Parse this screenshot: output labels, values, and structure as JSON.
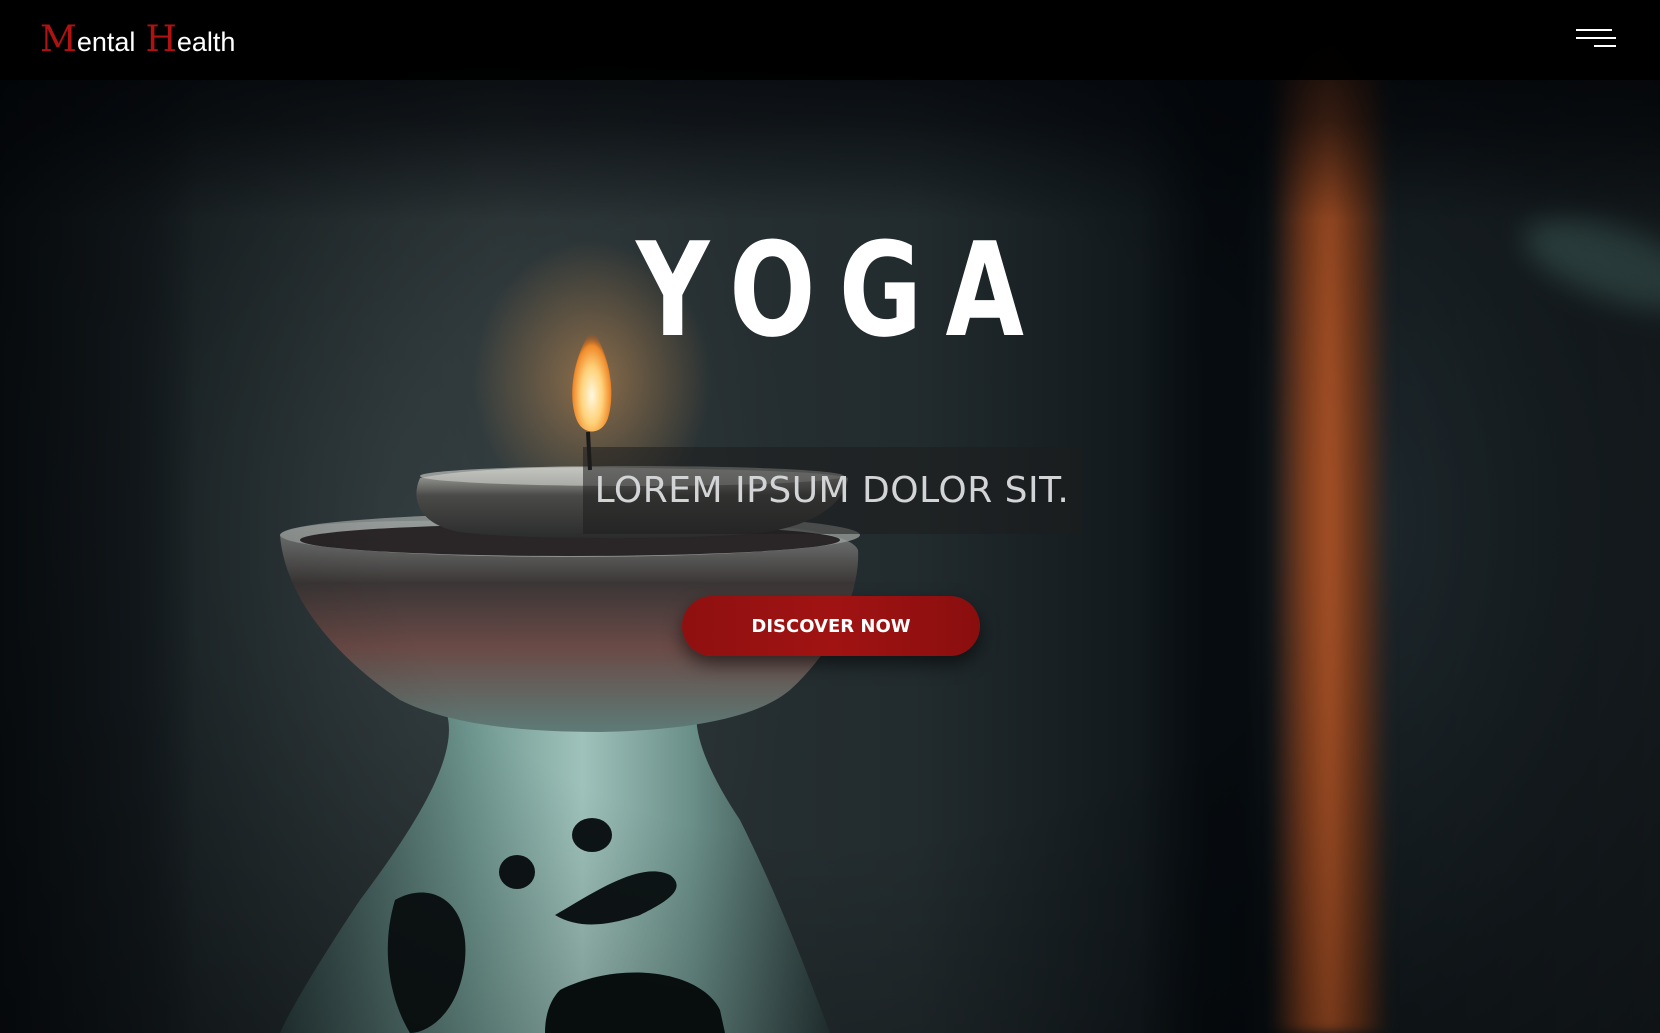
{
  "header": {
    "logo": {
      "word1_initial": "M",
      "word1_rest": "ental",
      "word2_initial": "H",
      "word2_rest": "ealth"
    },
    "menu_icon": "hamburger-menu-icon"
  },
  "hero": {
    "title": "YOGA",
    "subtitle": "LOREM IPSUM DOLOR SIT.",
    "cta_label": "DISCOVER NOW",
    "background_image": "candle on ceramic oil burner"
  },
  "colors": {
    "accent": "#b01212",
    "button": "#9b1212",
    "header_bg": "#000000",
    "text": "#ffffff"
  }
}
